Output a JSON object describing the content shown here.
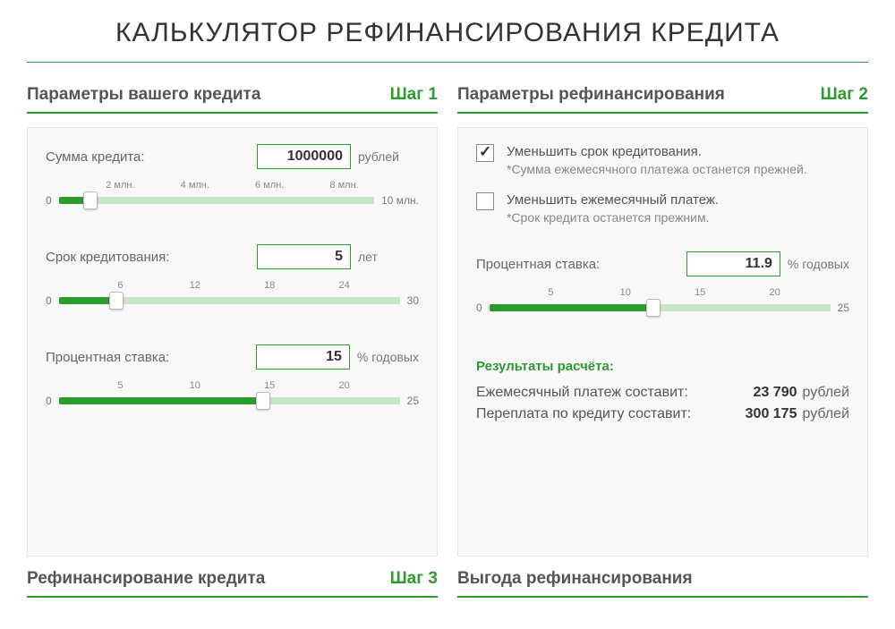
{
  "page": {
    "title": "КАЛЬКУЛЯТОР РЕФИНАНСИРОВАНИЯ КРЕДИТА"
  },
  "left": {
    "section_title": "Параметры вашего кредита",
    "step": "Шаг 1",
    "amount": {
      "label": "Сумма кредита:",
      "value": "1000000",
      "unit": "рублей",
      "min": "0",
      "max": "10 млн.",
      "ticks": [
        "2 млн.",
        "4 млн.",
        "6 млн.",
        "8 млн."
      ],
      "pct": 10
    },
    "term": {
      "label": "Срок кредитования:",
      "value": "5",
      "unit": "лет",
      "min": "0",
      "max": "30",
      "ticks": [
        "6",
        "12",
        "18",
        "24"
      ],
      "pct": 17
    },
    "rate": {
      "label": "Процентная ставка:",
      "value": "15",
      "unit": "% годовых",
      "min": "0",
      "max": "25",
      "ticks": [
        "5",
        "10",
        "15",
        "20"
      ],
      "pct": 60
    }
  },
  "right": {
    "section_title": "Параметры рефинансирования",
    "step": "Шаг 2",
    "opt1": {
      "label": "Уменьшить срок кредитования.",
      "note": "*Сумма ежемесячного платежа останется прежней."
    },
    "opt2": {
      "label": "Уменьшить ежемесячный платеж.",
      "note": "*Срок кредита останется прежним."
    },
    "rate": {
      "label": "Процентная ставка:",
      "value": "11.9",
      "unit": "% годовых",
      "min": "0",
      "max": "25",
      "ticks": [
        "5",
        "10",
        "15",
        "20"
      ],
      "pct": 48
    },
    "results": {
      "title": "Результаты расчёта:",
      "monthly_label": "Ежемесячный платеж составит:",
      "monthly_value": "23 790",
      "monthly_unit": "рублей",
      "overpay_label": "Переплата по кредиту составит:",
      "overpay_value": "300 175",
      "overpay_unit": "рублей"
    }
  },
  "step3": {
    "left_title": "Рефинансирование кредита",
    "left_step": "Шаг 3",
    "right_title": "Выгода рефинансирования"
  }
}
